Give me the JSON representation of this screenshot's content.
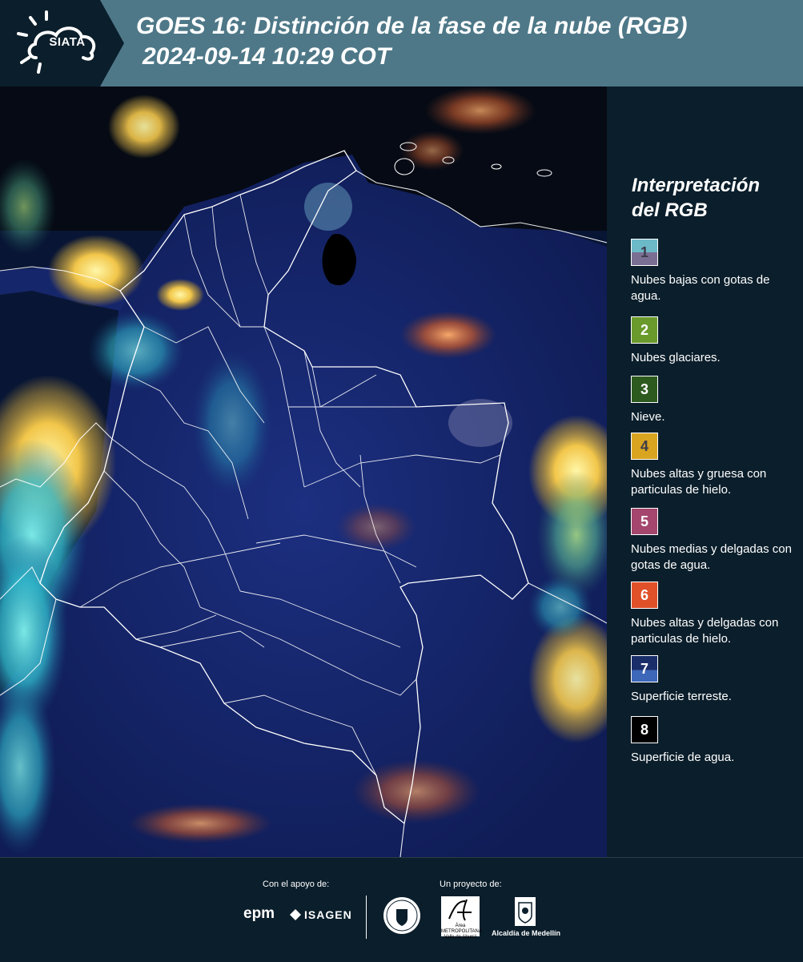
{
  "header": {
    "logo_text": "SIATA",
    "title_line1": "GOES 16: Distinción de la fase de la nube (RGB)",
    "title_line2": "2024-09-14 10:29 COT"
  },
  "legend": {
    "title_line1": "Interpretación",
    "title_line2": "del RGB",
    "items": [
      {
        "number": "1",
        "label": "Nubes bajas con gotas de agua.",
        "color": "#6cb9c8",
        "color2": "#7a6f92",
        "text_color": "#3c3c4a"
      },
      {
        "number": "2",
        "label": "Nubes glaciares.",
        "color": "#6a9a2c",
        "text_color": "#ffffff"
      },
      {
        "number": "3",
        "label": "Nieve.",
        "color": "#2d5a1e",
        "text_color": "#ffffff"
      },
      {
        "number": "4",
        "label": "Nubes altas y gruesa con particulas de hielo.",
        "color": "#d9a521",
        "text_color": "#3c3c4a"
      },
      {
        "number": "5",
        "label": "Nubes medias y delgadas con gotas de agua.",
        "color": "#a4466e",
        "text_color": "#ffffff"
      },
      {
        "number": "6",
        "label": "Nubes altas y delgadas con particulas de hielo.",
        "color": "#e0512a",
        "text_color": "#ffffff"
      },
      {
        "number": "7",
        "label": "Superficie terreste.",
        "color": "#1a2f6a",
        "color2": "#3d67b9",
        "text_color": "#ffffff"
      },
      {
        "number": "8",
        "label": "Superficie de agua.",
        "color": "#000000",
        "text_color": "#ffffff"
      }
    ]
  },
  "footer": {
    "support_label": "Con el apoyo de:",
    "project_label": "Un proyecto de:",
    "epm_text": "epm",
    "isagen_text": "ISAGEN",
    "area_text_main": "Área",
    "area_text_sub": "METROPOLITANA Valle de Aburrá",
    "alcaldia_text": "Alcaldía de Medellín"
  },
  "map": {
    "description_colors": {
      "land": "#13246a",
      "ocean": "#0a1540",
      "water_dark": "#000000",
      "cloud_warm": "#f2c64a",
      "cloud_cyan": "#44d2d6",
      "cloud_orange": "#d8713a",
      "borders": "#ffffff"
    }
  }
}
